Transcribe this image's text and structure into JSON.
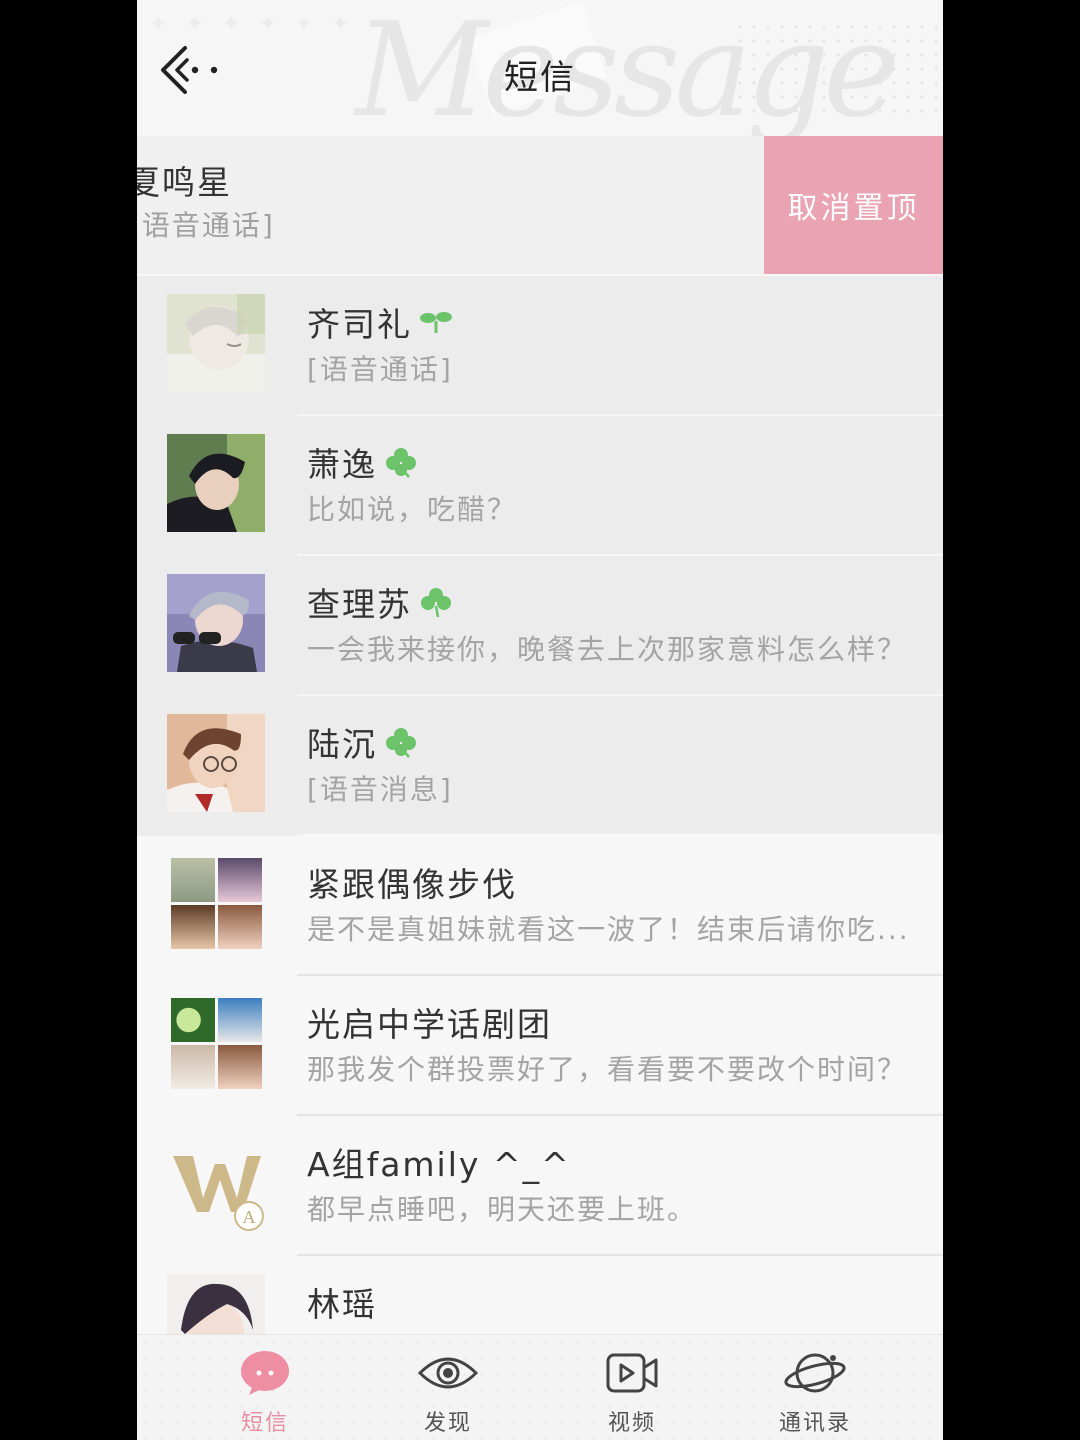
{
  "header": {
    "title": "短信",
    "watermark": "Message"
  },
  "pinned_swiped": {
    "name": "夏鸣星",
    "message": "[语音通话]",
    "action_label": "取消置顶"
  },
  "conversations": [
    {
      "name": "齐司礼",
      "message": "[语音通话]",
      "badge": "sprout-icon"
    },
    {
      "name": "萧逸",
      "message": "比如说，吃醋？",
      "badge": "clover-icon"
    },
    {
      "name": "查理苏",
      "message": "一会我来接你，晚餐去上次那家意料怎么样？",
      "badge": "clover-icon"
    },
    {
      "name": "陆沉",
      "message": "[语音消息]",
      "badge": "clover-icon"
    },
    {
      "name": "紧跟偶像步伐",
      "message": "是不是真姐妹就看这一波了！结束后请你吃..."
    },
    {
      "name": "光启中学话剧团",
      "message": "那我发个群投票好了，看看要不要改个时间？"
    },
    {
      "name": "A组family ^_^",
      "message": "都早点睡吧，明天还要上班。"
    },
    {
      "name": "林瑶",
      "message": ""
    }
  ],
  "bottom_nav": [
    {
      "label": "短信",
      "icon": "message-bubble-icon",
      "active": true
    },
    {
      "label": "发现",
      "icon": "eye-icon",
      "active": false
    },
    {
      "label": "视频",
      "icon": "video-icon",
      "active": false
    },
    {
      "label": "通讯录",
      "icon": "planet-icon",
      "active": false
    }
  ],
  "colors": {
    "accent": "#e9a3b3",
    "nav_active": "#e98fa3",
    "leaf": "#6cc36a"
  }
}
